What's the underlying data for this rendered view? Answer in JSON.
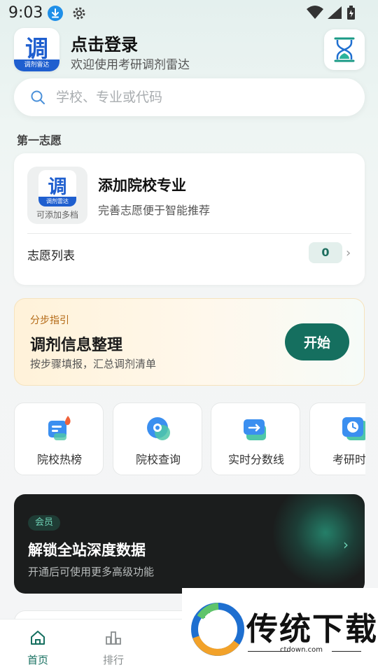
{
  "status_bar": {
    "time": "9:03"
  },
  "header": {
    "logo_glyph": "调",
    "logo_band": "调剂雷达",
    "title": "点击登录",
    "subtitle": "欢迎使用考研调剂雷达"
  },
  "search": {
    "placeholder": "学校、专业或代码"
  },
  "first_choice": {
    "section_label": "第一志愿",
    "icon_glyph": "调",
    "icon_band": "调剂雷达",
    "icon_caption": "可添加多档",
    "title": "添加院校专业",
    "description": "完善志愿便于智能推荐",
    "list_label": "志愿列表",
    "list_count": "0"
  },
  "guide": {
    "tag": "分步指引",
    "title": "调剂信息整理",
    "description": "按步骤填报，汇总调剂清单",
    "button_label": "开始"
  },
  "tools": [
    {
      "label": "院校热榜",
      "icon": "hot-list-icon"
    },
    {
      "label": "院校查询",
      "icon": "school-search-icon"
    },
    {
      "label": "实时分数线",
      "icon": "score-line-icon"
    },
    {
      "label": "考研时间",
      "icon": "clock-icon"
    }
  ],
  "vip": {
    "badge": "会员",
    "title": "解锁全站深度数据",
    "description": "开通后可使用更多高级功能",
    "accent": "#6fd3b6"
  },
  "tabbar": {
    "items": [
      {
        "label": "首页",
        "active": true
      },
      {
        "label": "排行",
        "active": false
      }
    ],
    "active_color": "#156f5f"
  },
  "watermark": {
    "text": "传统下载",
    "url": "ctdown.com"
  }
}
